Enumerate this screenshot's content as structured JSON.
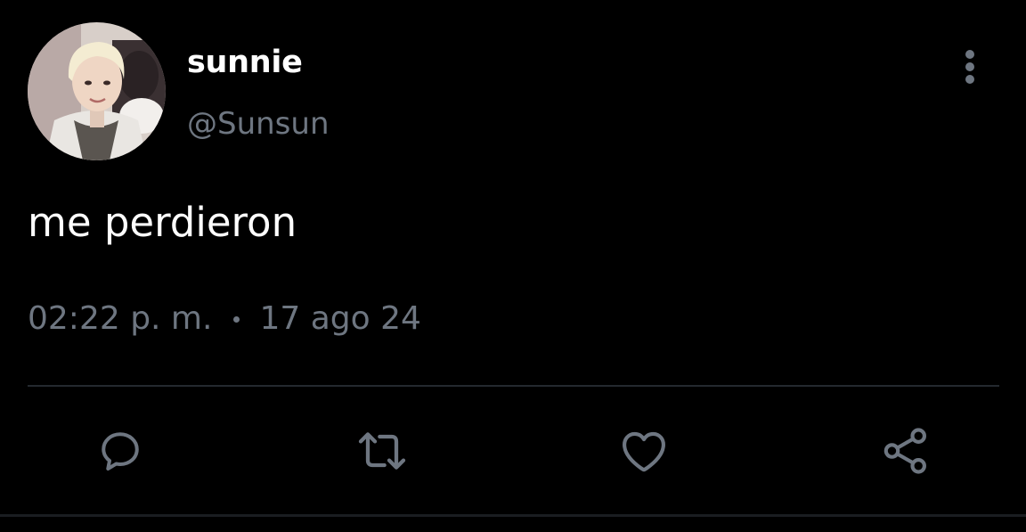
{
  "user": {
    "display_name": "sunnie",
    "handle": "@Sunsun"
  },
  "tweet": {
    "text": "me perdieron",
    "time": "02:22 p. m.",
    "date": "17 ago 24"
  },
  "icons": {
    "more": "more-vertical-icon",
    "reply": "reply-icon",
    "retweet": "retweet-icon",
    "like": "like-icon",
    "share": "share-icon"
  },
  "colors": {
    "background": "#000000",
    "text_primary": "#ffffff",
    "text_secondary": "#6e7681",
    "divider": "#24292f"
  }
}
